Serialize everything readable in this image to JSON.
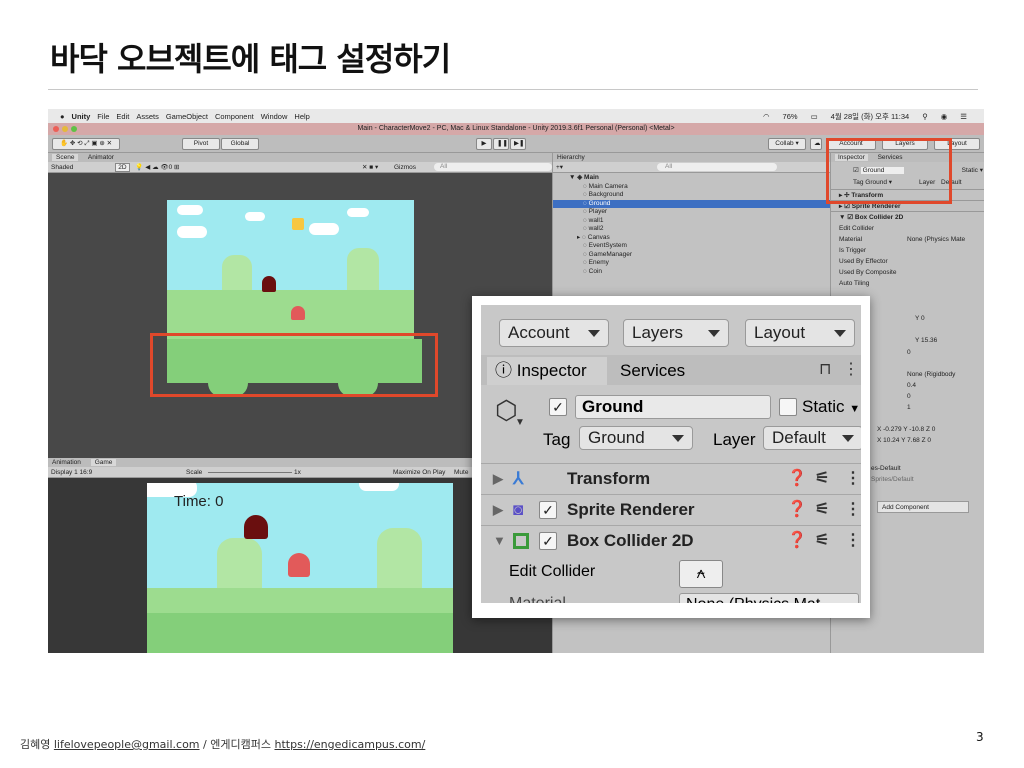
{
  "slide": {
    "title": "바닥 오브젝트에 태그 설정하기",
    "author": "김혜영",
    "email": "lifelovepeople@gmail.com",
    "separator": "/",
    "org": "엔게디캠퍼스",
    "url": "https://engedicampus.com/",
    "page": "3"
  },
  "mac_menu": {
    "apple": "",
    "items": [
      "Unity",
      "File",
      "Edit",
      "Assets",
      "GameObject",
      "Component",
      "Window",
      "Help"
    ],
    "battery": "76%",
    "clock": "4월 28일 (화) 오후 11:34"
  },
  "window_title": "Main - CharacterMove2 - PC, Mac & Linux Standalone - Unity 2019.3.6f1 Personal (Personal) <Metal>",
  "toolbar": {
    "pivot": "Pivot",
    "global": "Global",
    "collab": "Collab ▾",
    "account": "Account",
    "layers": "Layers",
    "layout": "Layout"
  },
  "scene": {
    "tab_scene": "Scene",
    "tab_animator": "Animator",
    "shading": "Shaded",
    "mode2d": "2D",
    "gizmos": "Gizmos",
    "search_placeholder": "All"
  },
  "game": {
    "tab_animation": "Animation",
    "tab_game": "Game",
    "display": "Display 1",
    "aspect": "16:9",
    "scale_label": "Scale",
    "scale_value": "1x",
    "maximize": "Maximize On Play",
    "mute": "Mute",
    "time_text": "Time: 0"
  },
  "hierarchy": {
    "title": "Hierarchy",
    "search_placeholder": "All",
    "scene": "Main",
    "items": [
      "Main Camera",
      "Background",
      "Ground",
      "Player",
      "wall1",
      "wall2",
      "Canvas",
      "EventSystem",
      "GameManager",
      "Enemy",
      "Coin"
    ],
    "selected_index": 2
  },
  "inspector_small": {
    "tab_inspector": "Inspector",
    "tab_services": "Services",
    "name": "Ground",
    "static": "Static ▾",
    "tag_label": "Tag",
    "tag_value": "Ground",
    "layer_label": "Layer",
    "layer_value": "Default",
    "components": [
      "Transform",
      "Sprite Renderer",
      "Box Collider 2D"
    ],
    "fields": [
      "Edit Collider",
      "Material",
      "Is Trigger",
      "Used By Effector",
      "Used By Composite",
      "Auto Tiling"
    ],
    "material_value": "None (Physics Mate",
    "y_val": "Y 0",
    "y_val2": "Y 15.36",
    "zero": "0",
    "rigidbody": "None (Rigidbody",
    "v04": "0.4",
    "v0": "0",
    "v1": "1",
    "x1": "X -0.279",
    "y1": "Y -10.8",
    "z1": "Z 0",
    "x2": "X 10.24",
    "y2": "Y 7.68",
    "z2": "Z 0",
    "sprites_default": "es-Default",
    "sprites_default2": "Sprites/Default",
    "add_component": "Add Component"
  },
  "zoom": {
    "account": "Account",
    "layers": "Layers",
    "layout": "Layout",
    "tab_inspector": "Inspector",
    "tab_services": "Services",
    "name": "Ground",
    "static": "Static",
    "tag_label": "Tag",
    "tag_value": "Ground",
    "layer_label": "Layer",
    "layer_value": "Default",
    "components": [
      {
        "name": "Transform",
        "has_check": false
      },
      {
        "name": "Sprite Renderer",
        "has_check": true
      },
      {
        "name": "Box Collider 2D",
        "has_check": true
      }
    ],
    "edit_collider": "Edit Collider",
    "material_cut": "Material",
    "material_value_cut": "None (Physics Mat"
  },
  "colors": {
    "highlight": "#e0482b",
    "selection": "#3d6fc2",
    "sky": "#9feaf0",
    "grass": "#84cf7a"
  }
}
